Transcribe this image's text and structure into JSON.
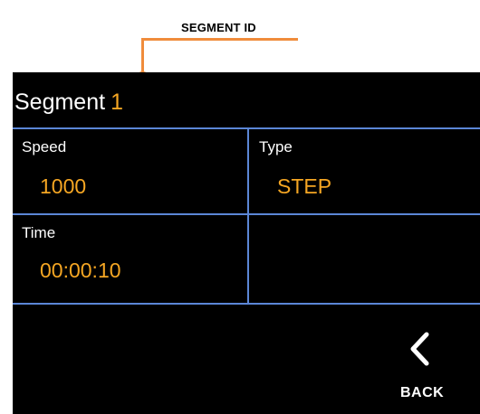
{
  "callout": {
    "label": "SEGMENT ID",
    "color": "#f08c3c"
  },
  "header": {
    "title": "Segment",
    "segment_id": "1"
  },
  "fields": {
    "speed": {
      "label": "Speed",
      "value": "1000"
    },
    "type": {
      "label": "Type",
      "value": "STEP"
    },
    "time": {
      "label": "Time",
      "value": "00:00:10"
    }
  },
  "actions": {
    "back": {
      "label": "BACK",
      "icon": "chevron-left-icon"
    }
  },
  "colors": {
    "screen_bg": "#000000",
    "accent_value": "#f5a623",
    "grid_line": "#5b86d6",
    "text": "#ffffff"
  }
}
